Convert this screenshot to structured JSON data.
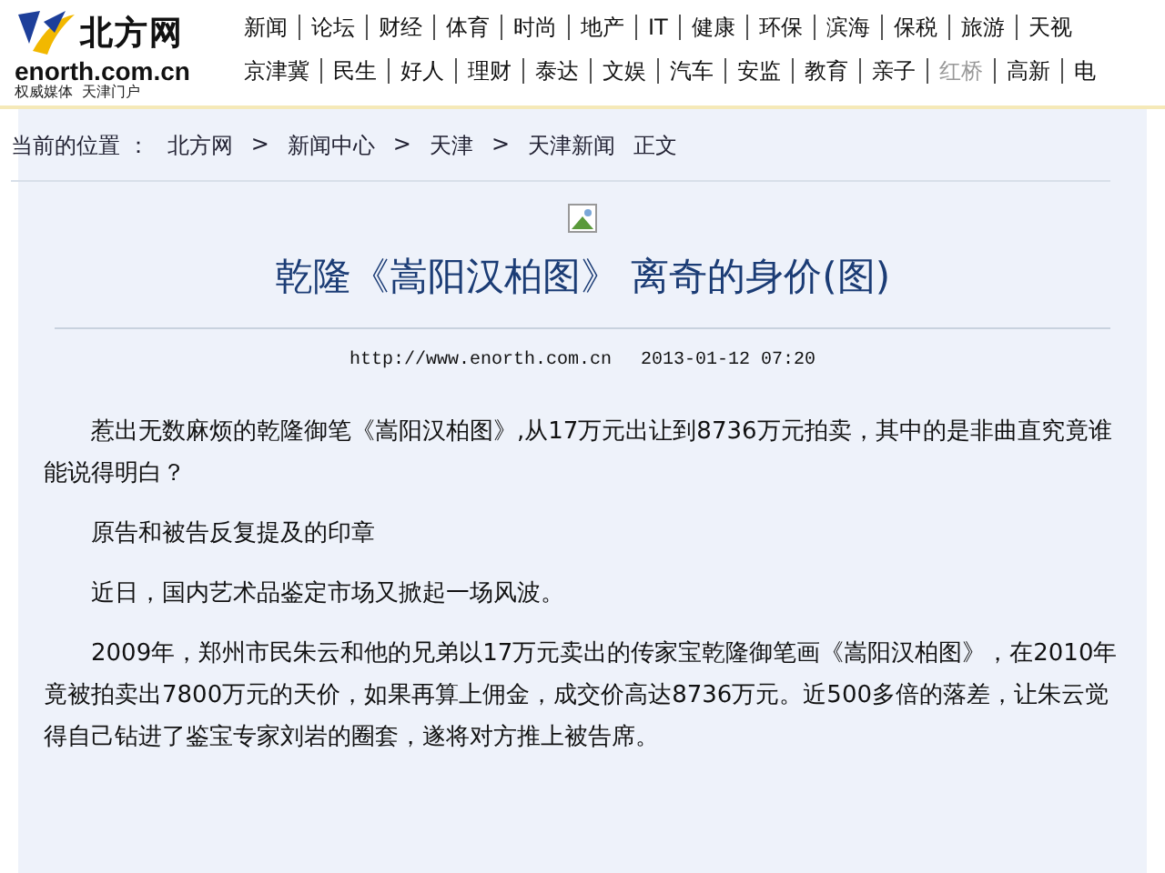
{
  "logo": {
    "name": "北方网",
    "domain": "enorth.com.cn",
    "slogan": "权威媒体  天津门户"
  },
  "nav_rows": [
    [
      {
        "label": "新闻",
        "muted": false
      },
      {
        "label": "论坛",
        "muted": false
      },
      {
        "label": "财经",
        "muted": false
      },
      {
        "label": "体育",
        "muted": false
      },
      {
        "label": "时尚",
        "muted": false
      },
      {
        "label": "地产",
        "muted": false
      },
      {
        "label": "IT",
        "muted": false
      },
      {
        "label": "健康",
        "muted": false
      },
      {
        "label": "环保",
        "muted": false
      },
      {
        "label": "滨海",
        "muted": false
      },
      {
        "label": "保税",
        "muted": false
      },
      {
        "label": "旅游",
        "muted": false
      },
      {
        "label": "天视",
        "muted": false
      }
    ],
    [
      {
        "label": "京津冀",
        "muted": false
      },
      {
        "label": "民生",
        "muted": false
      },
      {
        "label": "好人",
        "muted": false
      },
      {
        "label": "理财",
        "muted": false
      },
      {
        "label": "泰达",
        "muted": false
      },
      {
        "label": "文娱",
        "muted": false
      },
      {
        "label": "汽车",
        "muted": false
      },
      {
        "label": "安监",
        "muted": false
      },
      {
        "label": "教育",
        "muted": false
      },
      {
        "label": "亲子",
        "muted": false
      },
      {
        "label": "红桥",
        "muted": true
      },
      {
        "label": "高新",
        "muted": false
      },
      {
        "label": "电",
        "muted": false
      }
    ]
  ],
  "breadcrumb": {
    "prefix": "当前的位置 ：",
    "separator": ">",
    "items": [
      "北方网",
      "新闻中心",
      "天津",
      "天津新闻"
    ],
    "suffix": "正文"
  },
  "article": {
    "title": "乾隆《嵩阳汉柏图》 离奇的身价(图)",
    "source": "http://www.enorth.com.cn",
    "date": "2013-01-12 07:20",
    "paragraphs": [
      "惹出无数麻烦的乾隆御笔《嵩阳汉柏图》,从17万元出让到8736万元拍卖，其中的是非曲直究竟谁能说得明白？",
      "原告和被告反复提及的印章",
      "近日，国内艺术品鉴定市场又掀起一场风波。",
      "2009年，郑州市民朱云和他的兄弟以17万元卖出的传家宝乾隆御笔画《嵩阳汉柏图》，在2010年竟被拍卖出7800万元的天价，如果再算上佣金，成交价高达8736万元。近500多倍的落差，让朱云觉得自己钻进了鉴宝专家刘岩的圈套，遂将对方推上被告席。"
    ]
  }
}
